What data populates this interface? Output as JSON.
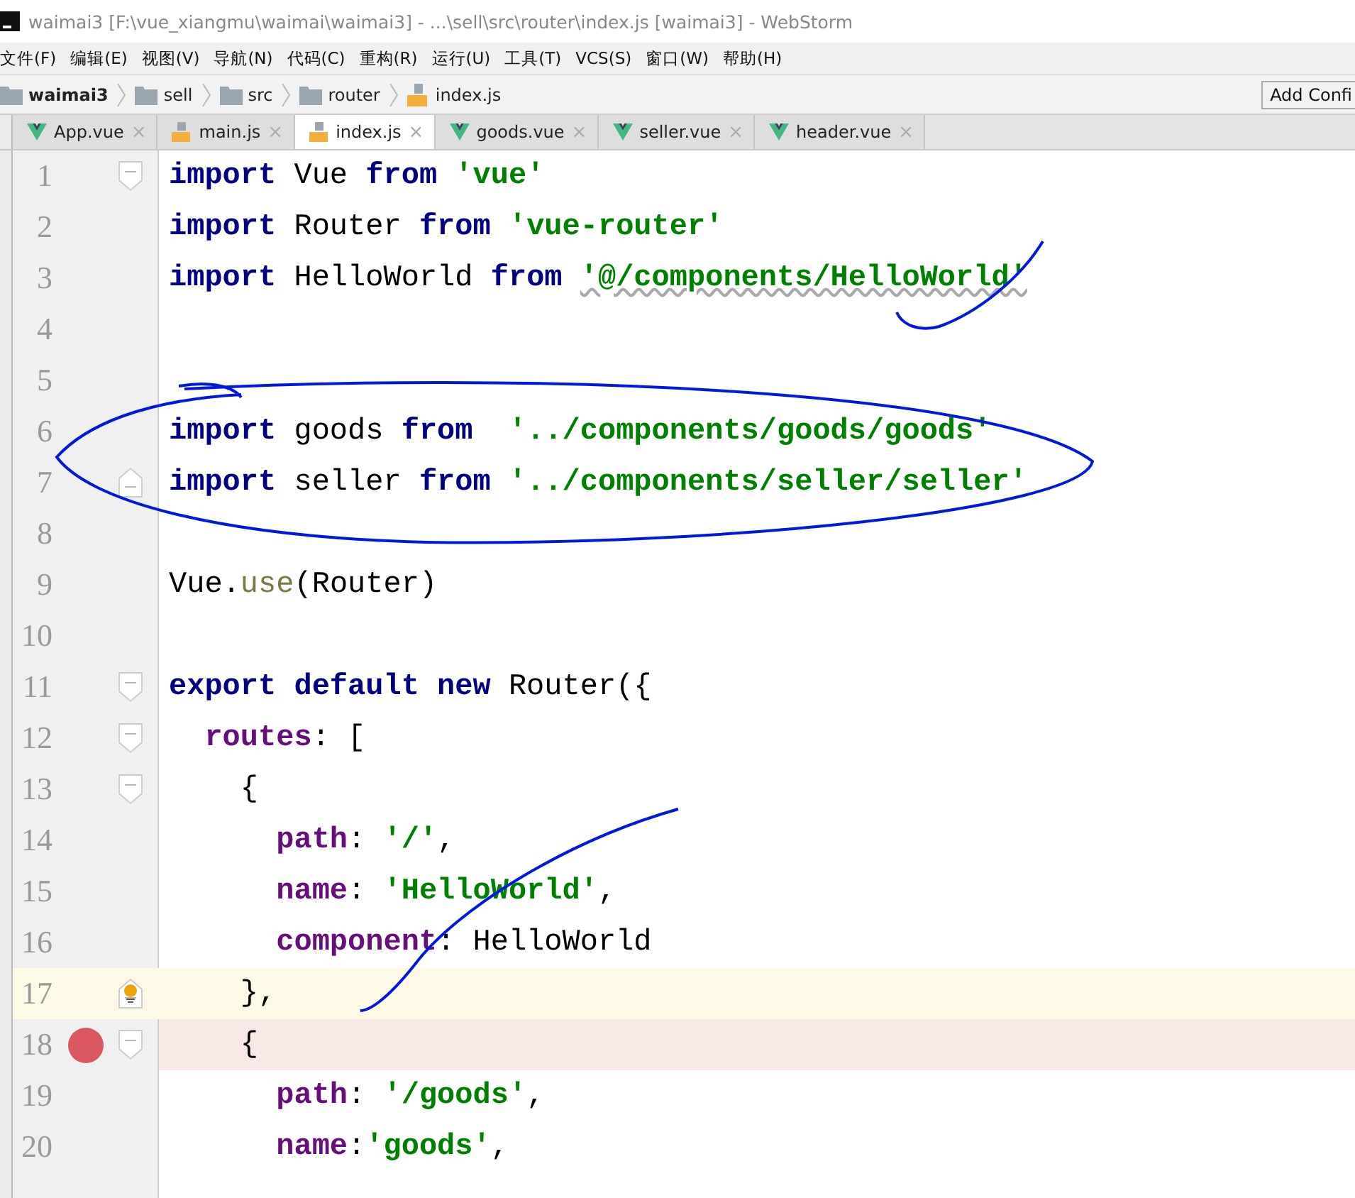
{
  "window": {
    "title": "waimai3 [F:\\vue_xiangmu\\waimai\\waimai3] - ...\\sell\\src\\router\\index.js [waimai3] - WebStorm"
  },
  "menu": [
    "文件(F)",
    "编辑(E)",
    "视图(V)",
    "导航(N)",
    "代码(C)",
    "重构(R)",
    "运行(U)",
    "工具(T)",
    "VCS(S)",
    "窗口(W)",
    "帮助(H)"
  ],
  "breadcrumbs": [
    {
      "kind": "project",
      "label": "waimai3"
    },
    {
      "kind": "folder",
      "label": "sell"
    },
    {
      "kind": "folder",
      "label": "src"
    },
    {
      "kind": "folder",
      "label": "router"
    },
    {
      "kind": "js",
      "label": "index.js"
    }
  ],
  "toolbar": {
    "button": "Add Confi"
  },
  "tabs": [
    {
      "kind": "vue",
      "label": "App.vue",
      "close": "×",
      "selected": false
    },
    {
      "kind": "js",
      "label": "main.js",
      "close": "×",
      "selected": false
    },
    {
      "kind": "js",
      "label": "index.js",
      "close": "×",
      "selected": true
    },
    {
      "kind": "vue",
      "label": "goods.vue",
      "close": "×",
      "selected": false
    },
    {
      "kind": "vue",
      "label": "seller.vue",
      "close": "×",
      "selected": false
    },
    {
      "kind": "vue",
      "label": "header.vue",
      "close": "×",
      "selected": false
    }
  ],
  "editor": {
    "lines": [
      {
        "number": "1",
        "fold_start": true,
        "tokens": [
          {
            "kind": "kw",
            "t": "import"
          },
          {
            "kind": "plain",
            "t": " Vue "
          },
          {
            "kind": "kw",
            "t": "from "
          },
          {
            "kind": "str",
            "t": "'vue'"
          }
        ]
      },
      {
        "number": "2",
        "tokens": [
          {
            "kind": "kw",
            "t": "import"
          },
          {
            "kind": "plain",
            "t": " Router "
          },
          {
            "kind": "kw",
            "t": "from "
          },
          {
            "kind": "str",
            "t": "'vue-router'"
          }
        ]
      },
      {
        "number": "3",
        "tokens": [
          {
            "kind": "kw",
            "t": "import"
          },
          {
            "kind": "plain",
            "t": " HelloWorld "
          },
          {
            "kind": "kw",
            "t": "from "
          },
          {
            "kind": "str",
            "t": "'@/components/HelloWorld'",
            "warning": true
          }
        ]
      },
      {
        "number": "4"
      },
      {
        "number": "5"
      },
      {
        "number": "6",
        "tokens": [
          {
            "kind": "kw",
            "t": "import"
          },
          {
            "kind": "plain",
            "t": " goods "
          },
          {
            "kind": "kw",
            "t": "from  "
          },
          {
            "kind": "str",
            "t": "'../components/goods/goods'"
          }
        ]
      },
      {
        "number": "7",
        "fold_end": true,
        "tokens": [
          {
            "kind": "kw",
            "t": "import"
          },
          {
            "kind": "plain",
            "t": " seller "
          },
          {
            "kind": "kw",
            "t": "from "
          },
          {
            "kind": "str",
            "t": "'../components/seller/seller'"
          }
        ]
      },
      {
        "number": "8"
      },
      {
        "number": "9",
        "tokens": [
          {
            "kind": "plain",
            "t": "Vue."
          },
          {
            "kind": "fn",
            "t": "use"
          },
          {
            "kind": "plain",
            "t": "(Router)"
          }
        ]
      },
      {
        "number": "10"
      },
      {
        "number": "11",
        "fold_start": true,
        "tokens": [
          {
            "kind": "kw",
            "t": "export default new"
          },
          {
            "kind": "plain",
            "t": " Router({"
          }
        ]
      },
      {
        "number": "12",
        "fold_start": true,
        "tokens": [
          {
            "kind": "prop",
            "t": "  routes"
          },
          {
            "kind": "plain",
            "t": ": ["
          }
        ]
      },
      {
        "number": "13",
        "fold_start": true,
        "tokens": [
          {
            "kind": "plain",
            "t": "    {"
          }
        ]
      },
      {
        "number": "14",
        "tokens": [
          {
            "kind": "prop",
            "t": "      path"
          },
          {
            "kind": "plain",
            "t": ": "
          },
          {
            "kind": "str",
            "t": "'/'"
          },
          {
            "kind": "plain",
            "t": ","
          }
        ]
      },
      {
        "number": "15",
        "tokens": [
          {
            "kind": "prop",
            "t": "      name"
          },
          {
            "kind": "plain",
            "t": ": "
          },
          {
            "kind": "str",
            "t": "'HelloWorld'"
          },
          {
            "kind": "plain",
            "t": ","
          }
        ]
      },
      {
        "number": "16",
        "tokens": [
          {
            "kind": "prop",
            "t": "      component"
          },
          {
            "kind": "plain",
            "t": ": HelloWorld"
          }
        ]
      },
      {
        "number": "17",
        "fold_end": true,
        "current": true,
        "bulb": true,
        "tokens": [
          {
            "kind": "plain",
            "t": "    },"
          }
        ]
      },
      {
        "number": "18",
        "fold_start": true,
        "breakpoint": true,
        "tokens": [
          {
            "kind": "plain",
            "t": "    {"
          }
        ]
      },
      {
        "number": "19",
        "tokens": [
          {
            "kind": "prop",
            "t": "      path"
          },
          {
            "kind": "plain",
            "t": ": "
          },
          {
            "kind": "str",
            "t": "'/goods'"
          },
          {
            "kind": "plain",
            "t": ","
          }
        ]
      },
      {
        "number": "20",
        "tokens": [
          {
            "kind": "prop",
            "t": "      name"
          },
          {
            "kind": "plain",
            "t": ":"
          },
          {
            "kind": "str",
            "t": "'goods'"
          },
          {
            "kind": "plain",
            "t": ","
          }
        ]
      }
    ]
  }
}
